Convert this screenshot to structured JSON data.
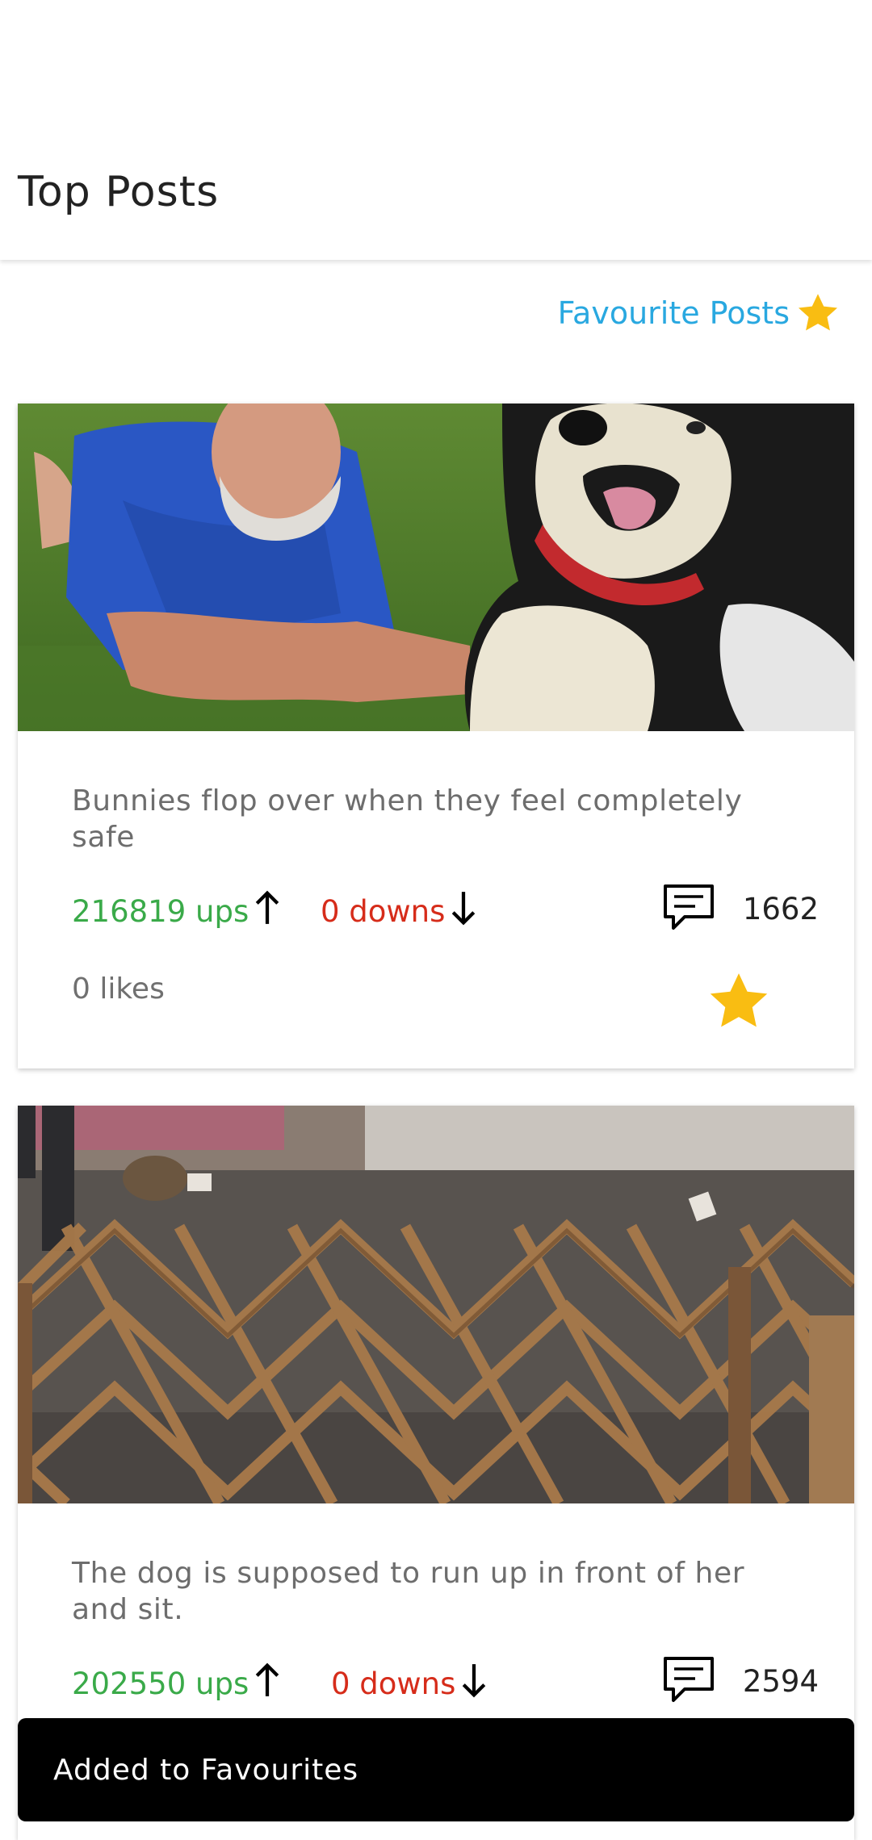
{
  "app_bar": {
    "title": "Top Posts"
  },
  "favourites_link": {
    "label": "Favourite Posts",
    "icon": "star-icon",
    "icon_color": "#f9bd12",
    "label_color": "#29a8e0"
  },
  "posts": [
    {
      "image": "man-with-husky-dog-photo",
      "title": "Bunnies flop over when they feel completely safe",
      "ups_label": "216819 ups",
      "downs_label": "0 downs",
      "comments": "1662",
      "likes_label": "0 likes",
      "favourited": true
    },
    {
      "image": "dog-behind-fence-photo",
      "title": "The dog is supposed to run up in front of her and sit.",
      "ups_label": "202550 ups",
      "downs_label": "0 downs",
      "comments": "2594"
    }
  ],
  "snackbar": {
    "message": "Added to Favourites"
  },
  "colors": {
    "ups": "#3aaa49",
    "downs": "#d62c1a",
    "star": "#f9bd12",
    "snackbar_bg": "#000000"
  }
}
